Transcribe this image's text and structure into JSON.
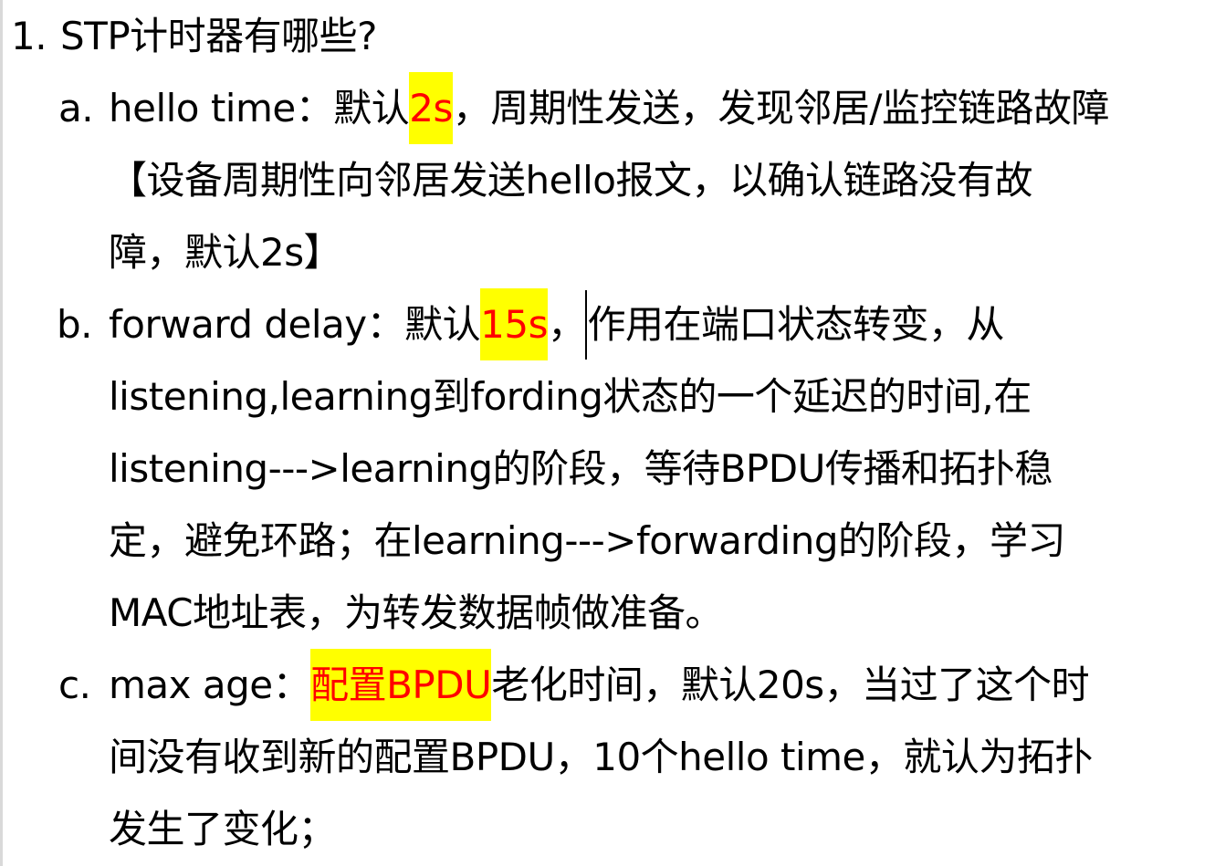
{
  "doc": {
    "item1": {
      "marker": "1.",
      "text": "STP计时器有哪些?"
    },
    "item_a": {
      "marker": "a.",
      "prefix": "hello time：默认",
      "highlight": "2s",
      "suffix": "，周期性发送，发现邻居/监控链路故障",
      "line2": "【设备周期性向邻居发送hello报文，以确认链路没有故",
      "line3": "障，默认2s】"
    },
    "item_b": {
      "marker": "b.",
      "prefix": "forward delay：默认",
      "highlight": "15s",
      "comma": "，",
      "suffix": "作用在端口状态转变，从",
      "line2": "listening,learning到fording状态的一个延迟的时间,在",
      "line3": "listening--->learning的阶段，等待BPDU传播和拓扑稳",
      "line4": "定，避免环路；在learning--->forwarding的阶段，学习",
      "line5": "MAC地址表，为转发数据帧做准备。"
    },
    "item_c": {
      "marker": "c.",
      "prefix": "max age：",
      "highlight": "配置BPDU",
      "suffix": "老化时间，默认20s，当过了这个时",
      "line2": "间没有收到新的配置BPDU，10个hello time，就认为拓扑",
      "line3": "发生了变化；"
    },
    "colors": {
      "highlight_bg": "#ffff00",
      "highlight_text": "#ff0000",
      "text": "#000000"
    }
  }
}
